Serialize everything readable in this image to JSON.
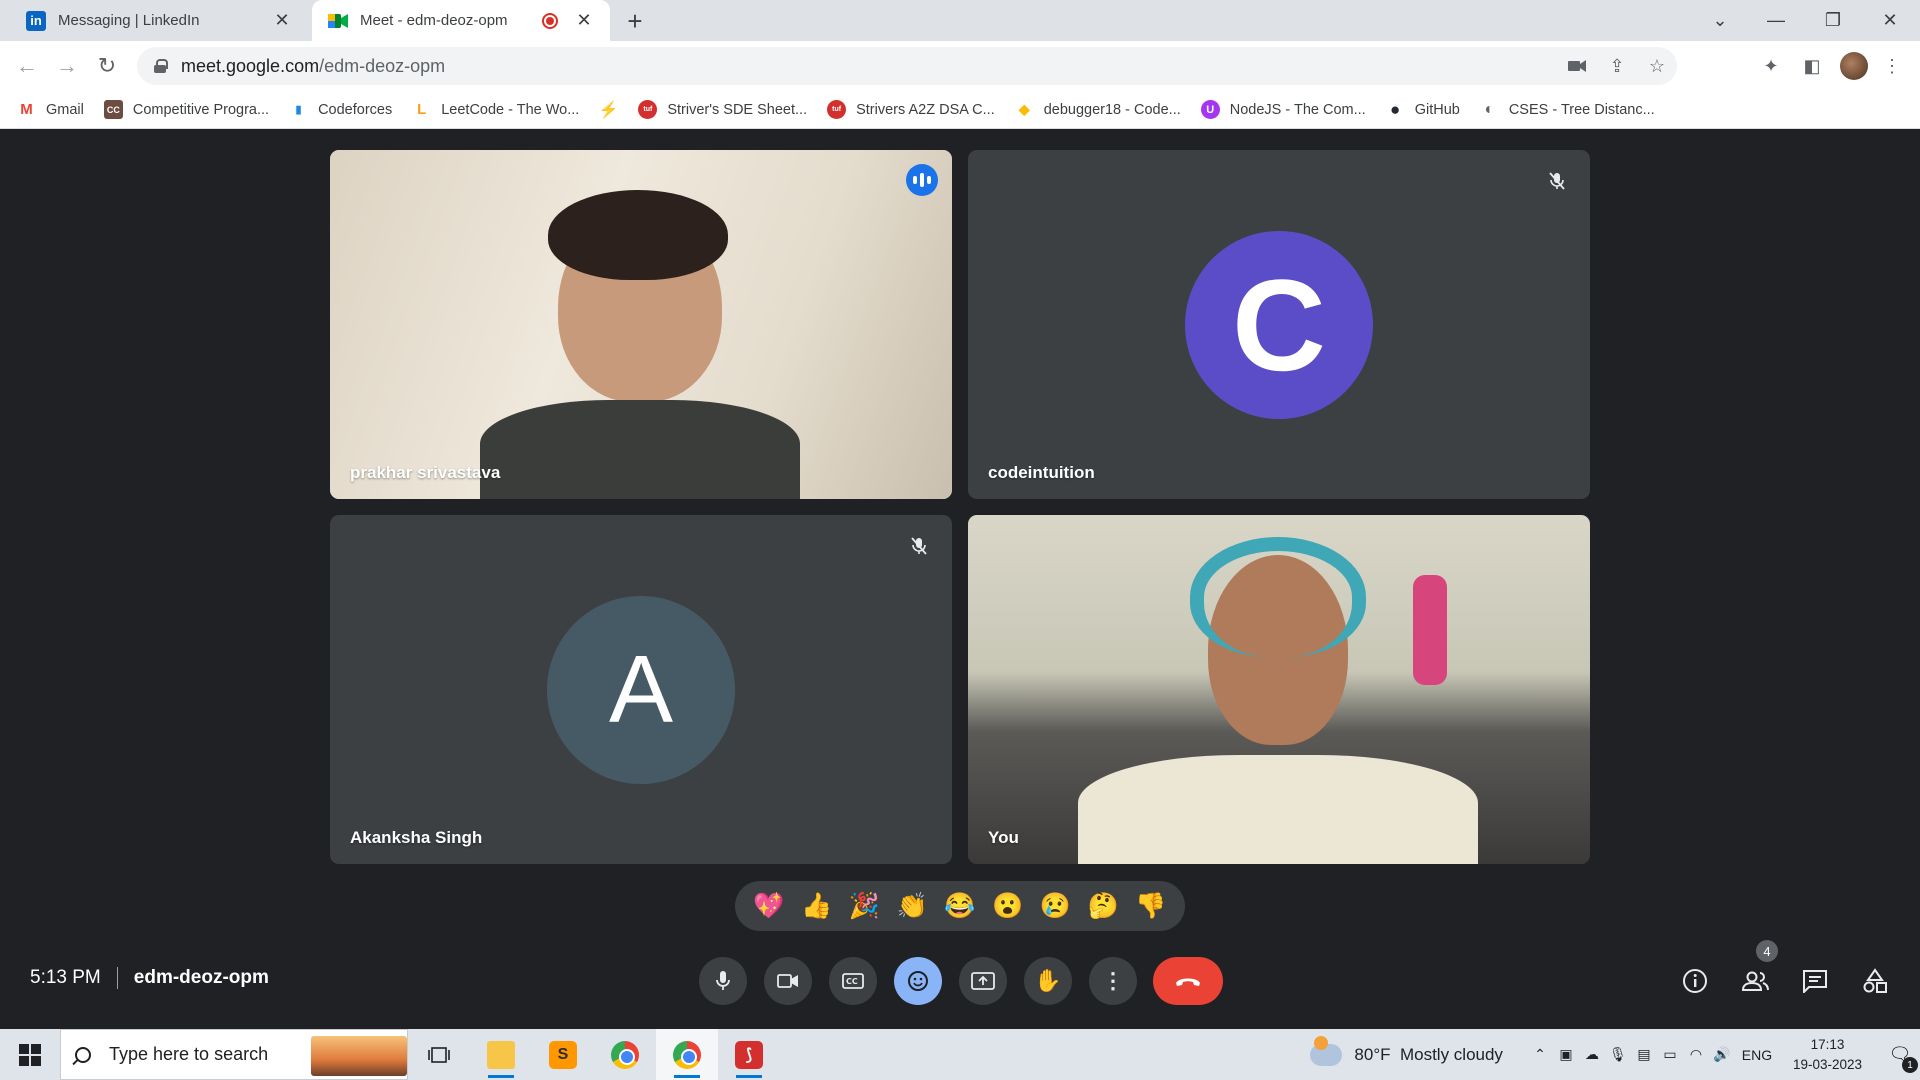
{
  "browser": {
    "tabs": [
      {
        "title": "Messaging | LinkedIn",
        "favicon": "in",
        "favicon_color": "#0a66c2"
      },
      {
        "title": "Meet - edm-deoz-opm",
        "favicon": "meet-icon",
        "recording": true
      }
    ],
    "url_host": "meet.google.com",
    "url_path": "/edm-deoz-opm",
    "bookmarks": [
      {
        "label": "Gmail",
        "icon": "M",
        "color": "#ea4335"
      },
      {
        "label": "Competitive Progra...",
        "icon": "CC",
        "color": "#6d4c41"
      },
      {
        "label": "Codeforces",
        "icon": "▮",
        "color": "#1e88e5"
      },
      {
        "label": "LeetCode - The Wo...",
        "icon": "L",
        "color": "#f89f1b"
      },
      {
        "label": "",
        "icon": "⚡",
        "color": "#fbbc05"
      },
      {
        "label": "Striver's SDE Sheet...",
        "icon": "tuf",
        "color": "#d32f2f"
      },
      {
        "label": "Strivers A2Z DSA C...",
        "icon": "tuf",
        "color": "#d32f2f"
      },
      {
        "label": "debugger18 - Code...",
        "icon": "◆",
        "color": "#fbbc05"
      },
      {
        "label": "NodeJS - The Com...",
        "icon": "U",
        "color": "#a435f0"
      },
      {
        "label": "GitHub",
        "icon": "●",
        "color": "#24292f"
      },
      {
        "label": "CSES - Tree Distanc...",
        "icon": "◐",
        "color": "#5f6368"
      }
    ]
  },
  "meet": {
    "participants": [
      {
        "name": "prakhar srivastava",
        "speaking": true
      },
      {
        "name": "codeintuition",
        "initial": "C",
        "avatar_color": "#5b4dc7",
        "muted": true
      },
      {
        "name": "Akanksha Singh",
        "initial": "A",
        "avatar_color": "#455a64",
        "muted": true
      },
      {
        "name": "You"
      }
    ],
    "reactions": [
      "💖",
      "👍",
      "🎉",
      "👏",
      "😂",
      "😮",
      "😢",
      "🤔",
      "👎"
    ],
    "time": "5:13 PM",
    "meeting_code": "edm-deoz-opm",
    "people_count": "4",
    "colors": {
      "hangup": "#ea4335",
      "active": "#8ab4f8",
      "tile": "#3c4043",
      "bg": "#202124"
    }
  },
  "taskbar": {
    "search_placeholder": "Type here to search",
    "weather_temp": "80°F",
    "weather_desc": "Mostly cloudy",
    "language": "ENG",
    "time": "17:13",
    "date": "19-03-2023",
    "notifications": "1"
  }
}
